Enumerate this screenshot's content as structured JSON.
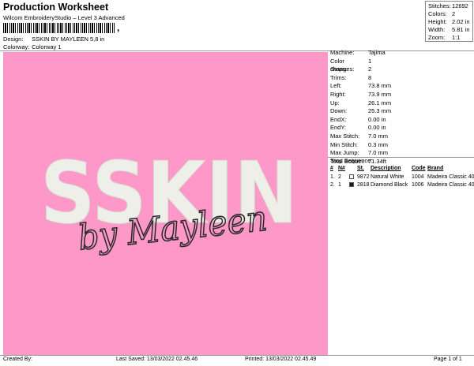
{
  "header": {
    "title": "Production Worksheet",
    "subtitle": "Wilcom EmbroideryStudio – Level 3 Advanced",
    "barcode_tail": ",",
    "design_label": "Design:",
    "design_value": "SSKIN BY MAYLEEN 5,8 in",
    "colorway_label": "Colorway:",
    "colorway_value": "Colorway 1"
  },
  "stats": [
    {
      "key": "Stitches:",
      "value": "12692"
    },
    {
      "key": "Colors:",
      "value": "2"
    },
    {
      "key": "Height:",
      "value": "2.02 in"
    },
    {
      "key": "Width:",
      "value": "5.81 in"
    },
    {
      "key": "Zoom:",
      "value": "1:1"
    }
  ],
  "design": {
    "main_text": "SSKIN",
    "script_text": "by Mayleen",
    "background_color": "#fe98c8",
    "thread_color_1": "#efefe9",
    "thread_color_2": "#2b2b2b"
  },
  "info": [
    {
      "key": "Machine:",
      "value": "Tajima"
    },
    {
      "key": "Color changes:",
      "value": "1"
    },
    {
      "key": "Stops:",
      "value": "2"
    },
    {
      "key": "Trims:",
      "value": "8"
    },
    {
      "key": "Left:",
      "value": "73.8 mm"
    },
    {
      "key": "Right:",
      "value": "73.9 mm"
    },
    {
      "key": "Up:",
      "value": "26.1 mm"
    },
    {
      "key": "Down:",
      "value": "25.3 mm"
    },
    {
      "key": "EndX:",
      "value": "0.00 in"
    },
    {
      "key": "EndY:",
      "value": "0.00 in"
    },
    {
      "key": "Max Stitch:",
      "value": "7.0 mm"
    },
    {
      "key": "Min Stitch:",
      "value": "0.3 mm"
    },
    {
      "key": "Max Jump:",
      "value": "7.0 mm"
    },
    {
      "key": "Total Bobbin:",
      "value": "71.34ft"
    }
  ],
  "stop_sequence": {
    "title": "Stop Sequence:",
    "headers": {
      "hash": "#",
      "n": "N#",
      "st": "St.",
      "desc": "Description",
      "code": "Code",
      "brand": "Brand"
    },
    "rows": [
      {
        "idx": "1.",
        "num": "2",
        "color": "#f4f4f0",
        "n": "9872",
        "desc": "Natural White",
        "code": "1004",
        "brand": "Madeira Classic 40"
      },
      {
        "idx": "2.",
        "num": "1",
        "color": "#1a1a1a",
        "n": "2818",
        "desc": "Diamond Black",
        "code": "1006",
        "brand": "Madeira Classic 40"
      }
    ]
  },
  "footer": {
    "created_by": "Created By:",
    "last_saved": "Last Saved: 13/03/2022 02.45.46",
    "printed": "Printed: 13/03/2022 02.45.49",
    "page": "Page 1 of 1"
  }
}
